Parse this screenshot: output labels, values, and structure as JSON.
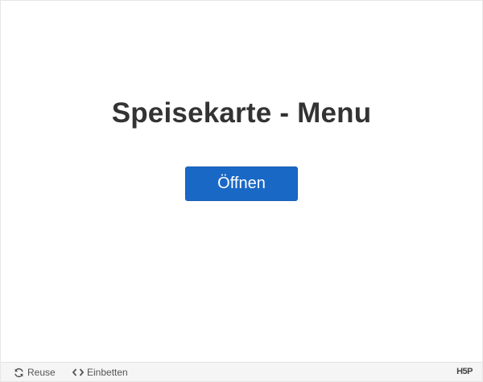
{
  "content": {
    "title": "Speisekarte - Menu",
    "open_button_label": "Öffnen"
  },
  "footer": {
    "reuse_label": "Reuse",
    "reuse_icon": "reuse-arrows-icon",
    "embed_label": "Einbetten",
    "embed_icon": "code-brackets-icon",
    "logo_text": "H5P"
  },
  "colors": {
    "accent": "#1a68c6",
    "title": "#333333",
    "footer_bg": "#f5f5f5"
  }
}
